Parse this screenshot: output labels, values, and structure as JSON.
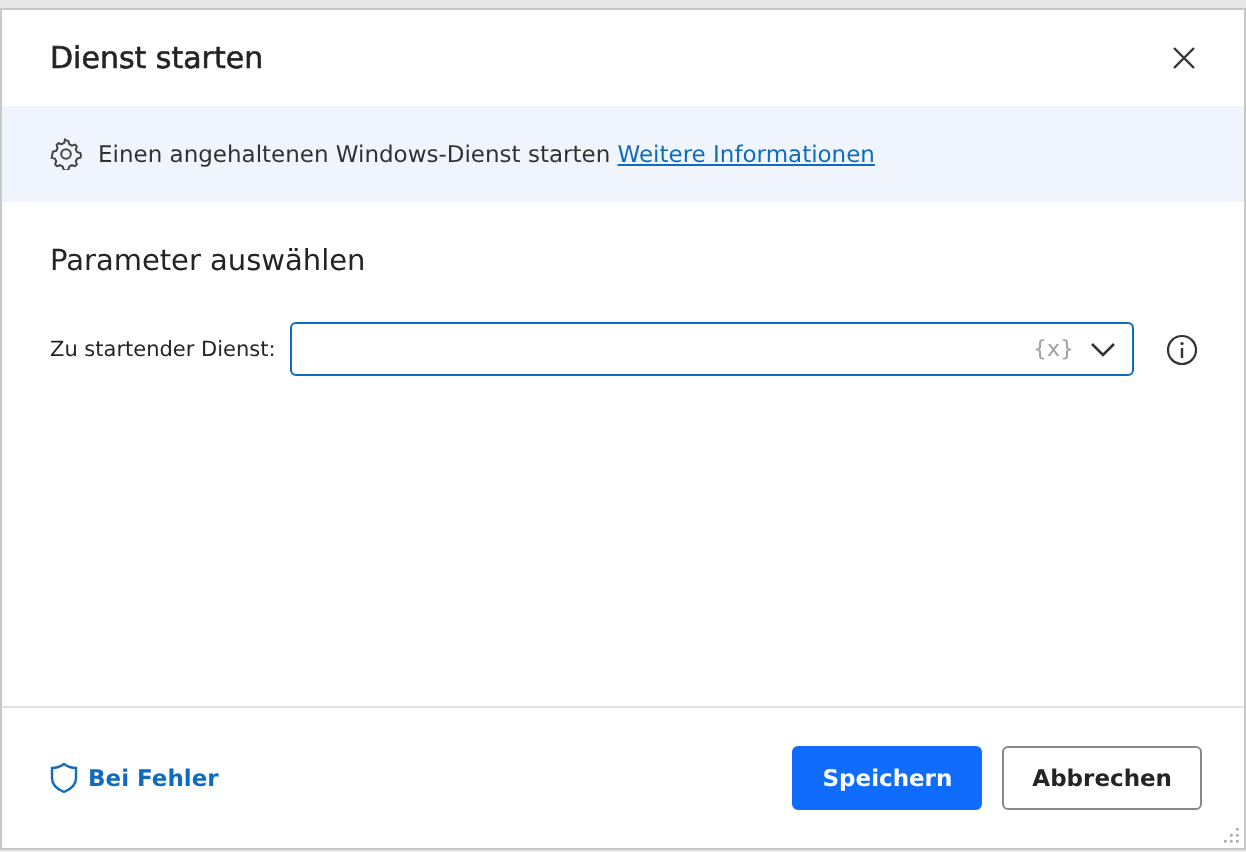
{
  "dialog": {
    "title": "Dienst starten"
  },
  "info": {
    "text": "Einen angehaltenen Windows-Dienst starten",
    "link": "Weitere Informationen"
  },
  "section": {
    "title": "Parameter auswählen"
  },
  "fields": [
    {
      "label": "Zu startender Dienst:",
      "variable_token": "{x}"
    }
  ],
  "footer": {
    "error_link": "Bei Fehler",
    "buttons": [
      {
        "label": "Speichern",
        "kind": "primary"
      },
      {
        "label": "Abbrechen",
        "kind": "secondary"
      }
    ]
  }
}
